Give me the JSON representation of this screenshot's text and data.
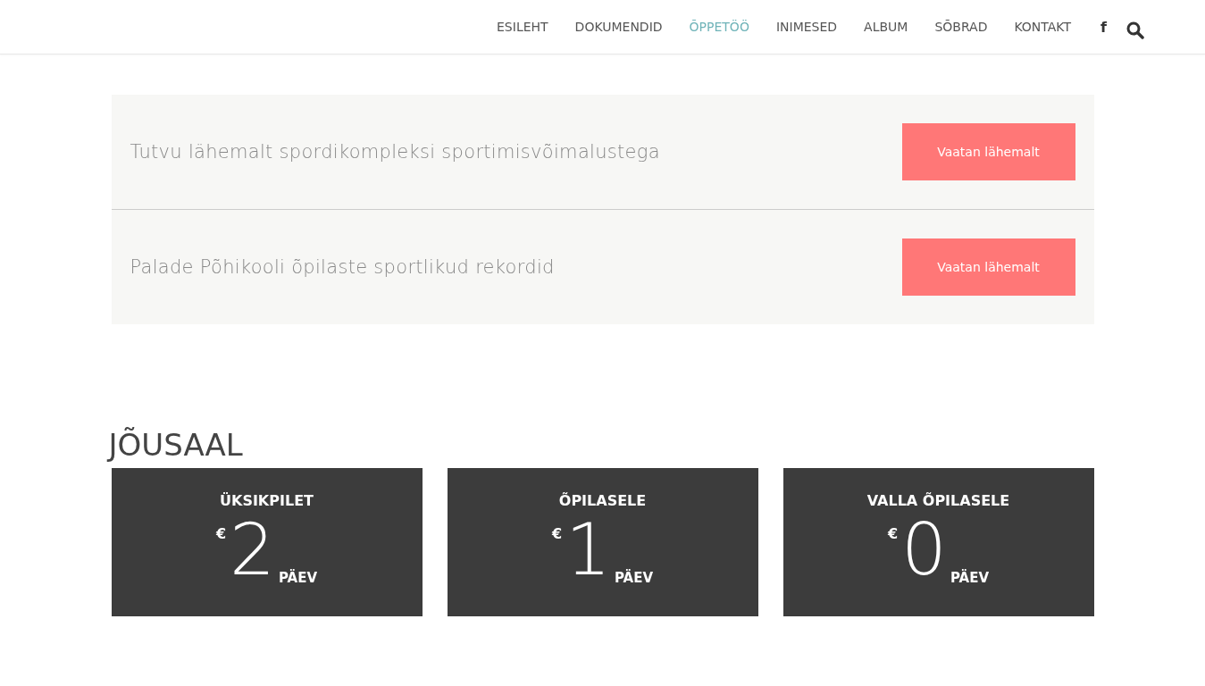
{
  "nav": {
    "items": [
      {
        "label": "ESILEHT",
        "selected": false
      },
      {
        "label": "DOKUMENDID",
        "selected": false
      },
      {
        "label": "ÕPPETÖÖ",
        "selected": true
      },
      {
        "label": "INIMESED",
        "selected": false
      },
      {
        "label": "ALBUM",
        "selected": false
      },
      {
        "label": "SÕBRAD",
        "selected": false
      },
      {
        "label": "KONTAKT",
        "selected": false
      }
    ],
    "facebook": "f"
  },
  "banners": [
    {
      "text": "Tutvu lähemalt spordikompleksi sportimisvõimalustega",
      "button": "Vaatan lähemalt"
    },
    {
      "text": "Palade Põhikooli õpilaste sportlikud rekordid",
      "button": "Vaatan lähemalt"
    }
  ],
  "section": {
    "title": "JÕUSAAL",
    "prices": [
      {
        "name": "ÜKSIKPILET",
        "currency": "€",
        "amount": "2",
        "unit": "PÄEV"
      },
      {
        "name": "ÕPILASELE",
        "currency": "€",
        "amount": "1",
        "unit": "PÄEV"
      },
      {
        "name": "VALLA ÕPILASELE",
        "currency": "€",
        "amount": "0",
        "unit": "PÄEV"
      }
    ]
  }
}
